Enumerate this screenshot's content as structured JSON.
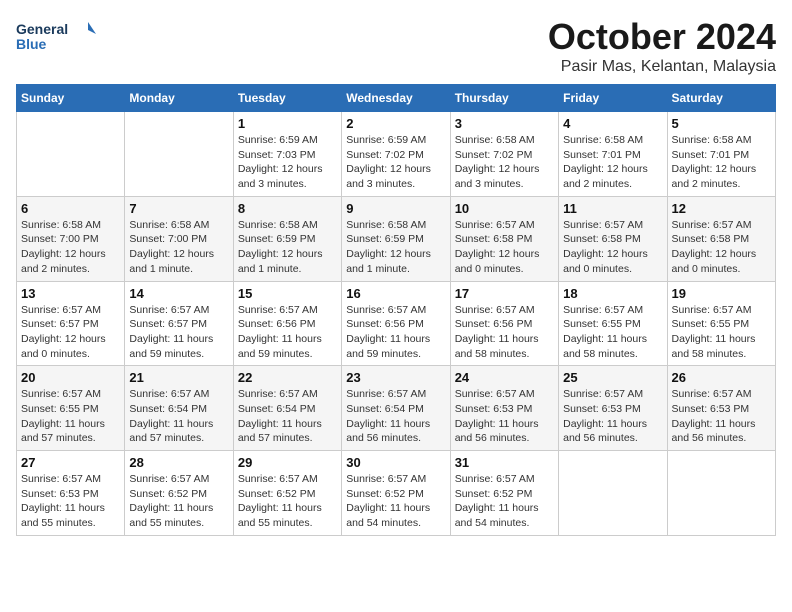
{
  "logo": {
    "line1": "General",
    "line2": "Blue"
  },
  "header": {
    "month": "October 2024",
    "location": "Pasir Mas, Kelantan, Malaysia"
  },
  "weekdays": [
    "Sunday",
    "Monday",
    "Tuesday",
    "Wednesday",
    "Thursday",
    "Friday",
    "Saturday"
  ],
  "weeks": [
    [
      {
        "day": "",
        "info": ""
      },
      {
        "day": "",
        "info": ""
      },
      {
        "day": "1",
        "info": "Sunrise: 6:59 AM\nSunset: 7:03 PM\nDaylight: 12 hours\nand 3 minutes."
      },
      {
        "day": "2",
        "info": "Sunrise: 6:59 AM\nSunset: 7:02 PM\nDaylight: 12 hours\nand 3 minutes."
      },
      {
        "day": "3",
        "info": "Sunrise: 6:58 AM\nSunset: 7:02 PM\nDaylight: 12 hours\nand 3 minutes."
      },
      {
        "day": "4",
        "info": "Sunrise: 6:58 AM\nSunset: 7:01 PM\nDaylight: 12 hours\nand 2 minutes."
      },
      {
        "day": "5",
        "info": "Sunrise: 6:58 AM\nSunset: 7:01 PM\nDaylight: 12 hours\nand 2 minutes."
      }
    ],
    [
      {
        "day": "6",
        "info": "Sunrise: 6:58 AM\nSunset: 7:00 PM\nDaylight: 12 hours\nand 2 minutes."
      },
      {
        "day": "7",
        "info": "Sunrise: 6:58 AM\nSunset: 7:00 PM\nDaylight: 12 hours\nand 1 minute."
      },
      {
        "day": "8",
        "info": "Sunrise: 6:58 AM\nSunset: 6:59 PM\nDaylight: 12 hours\nand 1 minute."
      },
      {
        "day": "9",
        "info": "Sunrise: 6:58 AM\nSunset: 6:59 PM\nDaylight: 12 hours\nand 1 minute."
      },
      {
        "day": "10",
        "info": "Sunrise: 6:57 AM\nSunset: 6:58 PM\nDaylight: 12 hours\nand 0 minutes."
      },
      {
        "day": "11",
        "info": "Sunrise: 6:57 AM\nSunset: 6:58 PM\nDaylight: 12 hours\nand 0 minutes."
      },
      {
        "day": "12",
        "info": "Sunrise: 6:57 AM\nSunset: 6:58 PM\nDaylight: 12 hours\nand 0 minutes."
      }
    ],
    [
      {
        "day": "13",
        "info": "Sunrise: 6:57 AM\nSunset: 6:57 PM\nDaylight: 12 hours\nand 0 minutes."
      },
      {
        "day": "14",
        "info": "Sunrise: 6:57 AM\nSunset: 6:57 PM\nDaylight: 11 hours\nand 59 minutes."
      },
      {
        "day": "15",
        "info": "Sunrise: 6:57 AM\nSunset: 6:56 PM\nDaylight: 11 hours\nand 59 minutes."
      },
      {
        "day": "16",
        "info": "Sunrise: 6:57 AM\nSunset: 6:56 PM\nDaylight: 11 hours\nand 59 minutes."
      },
      {
        "day": "17",
        "info": "Sunrise: 6:57 AM\nSunset: 6:56 PM\nDaylight: 11 hours\nand 58 minutes."
      },
      {
        "day": "18",
        "info": "Sunrise: 6:57 AM\nSunset: 6:55 PM\nDaylight: 11 hours\nand 58 minutes."
      },
      {
        "day": "19",
        "info": "Sunrise: 6:57 AM\nSunset: 6:55 PM\nDaylight: 11 hours\nand 58 minutes."
      }
    ],
    [
      {
        "day": "20",
        "info": "Sunrise: 6:57 AM\nSunset: 6:55 PM\nDaylight: 11 hours\nand 57 minutes."
      },
      {
        "day": "21",
        "info": "Sunrise: 6:57 AM\nSunset: 6:54 PM\nDaylight: 11 hours\nand 57 minutes."
      },
      {
        "day": "22",
        "info": "Sunrise: 6:57 AM\nSunset: 6:54 PM\nDaylight: 11 hours\nand 57 minutes."
      },
      {
        "day": "23",
        "info": "Sunrise: 6:57 AM\nSunset: 6:54 PM\nDaylight: 11 hours\nand 56 minutes."
      },
      {
        "day": "24",
        "info": "Sunrise: 6:57 AM\nSunset: 6:53 PM\nDaylight: 11 hours\nand 56 minutes."
      },
      {
        "day": "25",
        "info": "Sunrise: 6:57 AM\nSunset: 6:53 PM\nDaylight: 11 hours\nand 56 minutes."
      },
      {
        "day": "26",
        "info": "Sunrise: 6:57 AM\nSunset: 6:53 PM\nDaylight: 11 hours\nand 56 minutes."
      }
    ],
    [
      {
        "day": "27",
        "info": "Sunrise: 6:57 AM\nSunset: 6:53 PM\nDaylight: 11 hours\nand 55 minutes."
      },
      {
        "day": "28",
        "info": "Sunrise: 6:57 AM\nSunset: 6:52 PM\nDaylight: 11 hours\nand 55 minutes."
      },
      {
        "day": "29",
        "info": "Sunrise: 6:57 AM\nSunset: 6:52 PM\nDaylight: 11 hours\nand 55 minutes."
      },
      {
        "day": "30",
        "info": "Sunrise: 6:57 AM\nSunset: 6:52 PM\nDaylight: 11 hours\nand 54 minutes."
      },
      {
        "day": "31",
        "info": "Sunrise: 6:57 AM\nSunset: 6:52 PM\nDaylight: 11 hours\nand 54 minutes."
      },
      {
        "day": "",
        "info": ""
      },
      {
        "day": "",
        "info": ""
      }
    ]
  ]
}
